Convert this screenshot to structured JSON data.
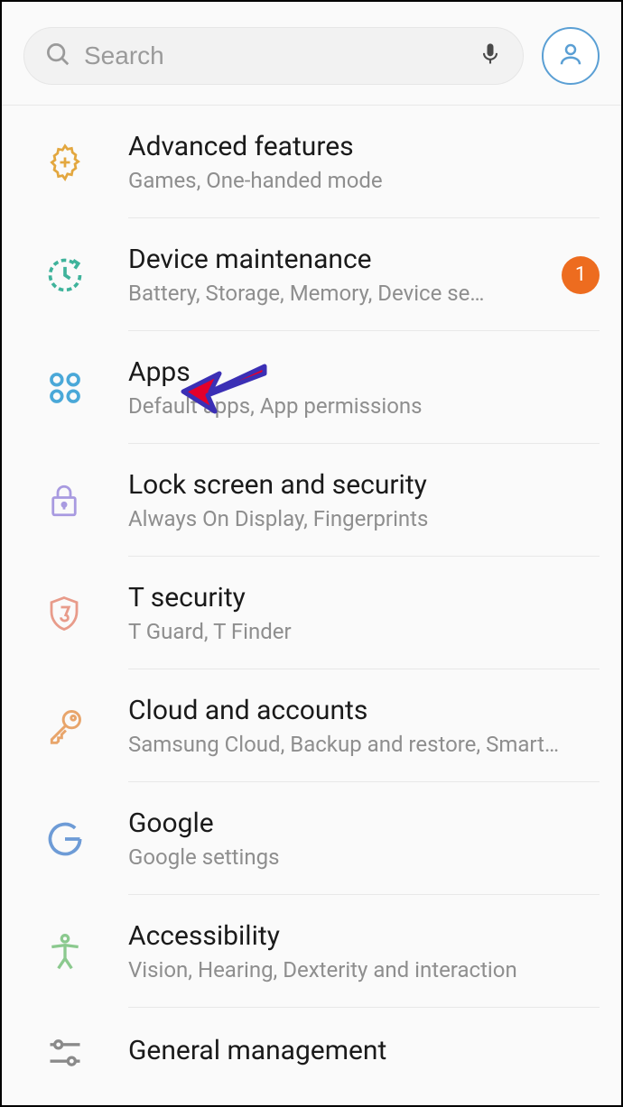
{
  "search": {
    "placeholder": "Search"
  },
  "items": [
    {
      "title": "Advanced features",
      "subtitle": "Games, One-handed mode"
    },
    {
      "title": "Device maintenance",
      "subtitle": "Battery, Storage, Memory, Device se…",
      "badge": "1"
    },
    {
      "title": "Apps",
      "subtitle": "Default apps, App permissions"
    },
    {
      "title": "Lock screen and security",
      "subtitle": "Always On Display, Fingerprints"
    },
    {
      "title": "T security",
      "subtitle": "T Guard, T Finder"
    },
    {
      "title": "Cloud and accounts",
      "subtitle": "Samsung Cloud, Backup and restore, Smart…"
    },
    {
      "title": "Google",
      "subtitle": "Google settings"
    },
    {
      "title": "Accessibility",
      "subtitle": "Vision, Hearing, Dexterity and interaction"
    },
    {
      "title": "General management",
      "subtitle": ""
    }
  ]
}
